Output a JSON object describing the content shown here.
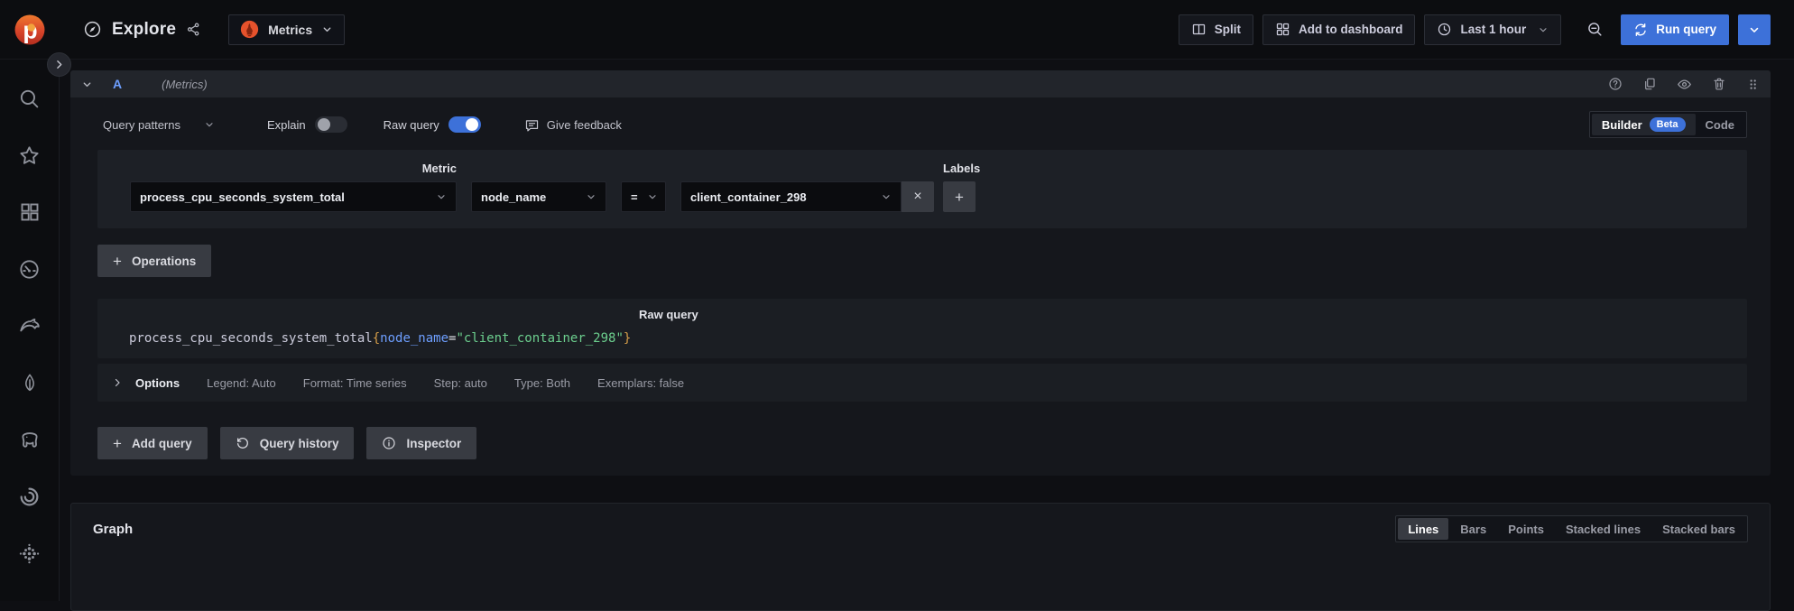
{
  "nav": {
    "page_title": "Explore",
    "datasource_picker": {
      "value": "Metrics"
    },
    "split_label": "Split",
    "add_to_dashboard_label": "Add to dashboard",
    "time_range_label": "Last 1 hour",
    "run_query_label": "Run query"
  },
  "query_row": {
    "ref_id": "A",
    "datasource_hint": "(Metrics)",
    "toolbar": {
      "query_patterns_label": "Query patterns",
      "explain_label": "Explain",
      "raw_query_toggle_label": "Raw query",
      "give_feedback_label": "Give feedback",
      "builder_label": "Builder",
      "beta_badge": "Beta",
      "code_label": "Code"
    },
    "builder": {
      "metric_field_label": "Metric",
      "metric_value": "process_cpu_seconds_system_total",
      "labels_field_label": "Labels",
      "label_name": "node_name",
      "operator": "=",
      "label_value": "client_container_298"
    },
    "operations_label": "Operations",
    "raw_query": {
      "label": "Raw query",
      "expr_metric": "process_cpu_seconds_system_total",
      "expr_open_brace": "{",
      "expr_label_name": "node_name",
      "expr_equals": "=",
      "expr_label_value": "\"client_container_298\"",
      "expr_close_brace": "}"
    },
    "options": {
      "title": "Options",
      "legend": "Legend: Auto",
      "format": "Format: Time series",
      "step": "Step: auto",
      "type": "Type: Both",
      "exemplars": "Exemplars: false"
    },
    "add_query_label": "Add query",
    "query_history_label": "Query history",
    "inspector_label": "Inspector"
  },
  "graph": {
    "title": "Graph",
    "style_options": [
      "Lines",
      "Bars",
      "Points",
      "Stacked lines",
      "Stacked bars"
    ],
    "selected_style": "Lines"
  },
  "glyphs": {
    "plus": "+",
    "close": "×"
  },
  "colors": {
    "accent_blue": "#3d71d9",
    "datasource_orange": "#e6522c",
    "ref_id_blue": "#6e9fff",
    "syntax_label_name": "#6e9fff",
    "syntax_string": "#6ccf8e",
    "syntax_brace": "#d69e49"
  }
}
